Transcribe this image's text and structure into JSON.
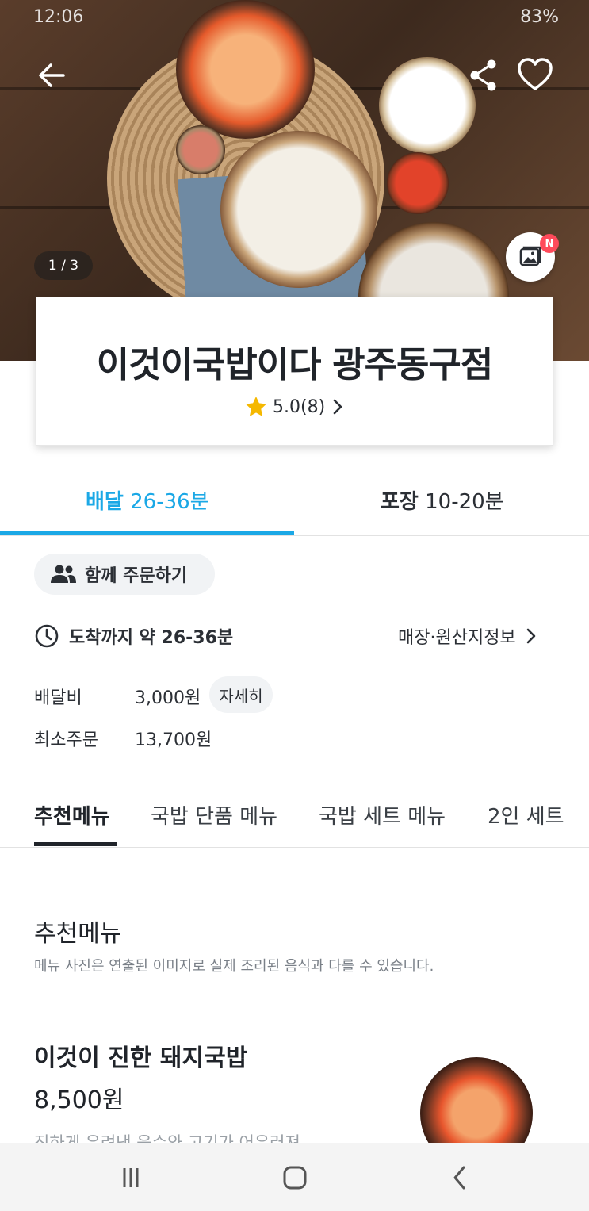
{
  "status_bar": {
    "time": "12:06",
    "battery": "83%"
  },
  "hero": {
    "counter": "1 / 3",
    "new_badge": "N"
  },
  "store": {
    "name": "이것이국밥이다 광주동구점",
    "rating": "5.0(8)"
  },
  "delivery_tabs": {
    "delivery_label": "배달",
    "delivery_time": "26-36분",
    "pickup_label": "포장",
    "pickup_time": "10-20분"
  },
  "group_order_label": "함께 주문하기",
  "arrival": {
    "text": "도착까지 약 26-36분"
  },
  "store_info_link": "매장·원산지정보",
  "fees": {
    "delivery_fee_label": "배달비",
    "delivery_fee_value": "3,000원",
    "detail_label": "자세히",
    "min_order_label": "최소주문",
    "min_order_value": "13,700원"
  },
  "menu_tabs": [
    "추천메뉴",
    "국밥 단품 메뉴",
    "국밥 세트 메뉴",
    "2인 세트"
  ],
  "section": {
    "title": "추천메뉴",
    "note": "메뉴 사진은 연출된 이미지로 실제 조리된 음식과 다를 수 있습니다."
  },
  "menu_item": {
    "name": "이것이 진한 돼지국밥",
    "price": "8,500원",
    "description": "진하게 우려낸 육수와 고기가 어우러져"
  },
  "colors": {
    "accent": "#1ba8e6",
    "star": "#f5b800",
    "badge": "#ff4a5a"
  }
}
